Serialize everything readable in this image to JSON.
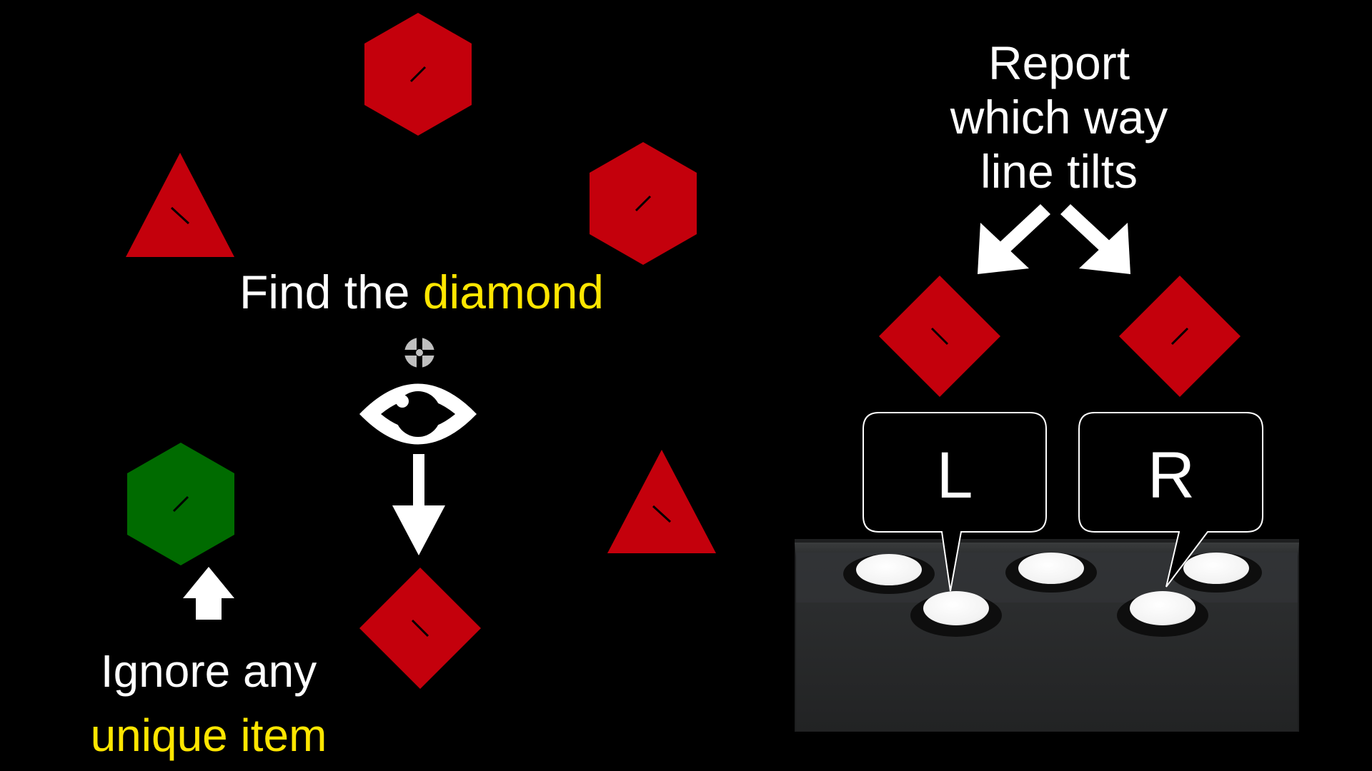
{
  "instructions": {
    "find_prefix": "Find the ",
    "find_target": "diamond",
    "ignore_line1": "Ignore any",
    "ignore_line2": "unique item",
    "report_line1": "Report",
    "report_line2": "which way",
    "report_line3": "line tilts"
  },
  "response_keys": {
    "left_label": "L",
    "right_label": "R"
  },
  "colors": {
    "background": "#000000",
    "distractor_red": "#c4000c",
    "singleton_green": "#006b00",
    "highlight_text": "#ffe600",
    "text": "#ffffff",
    "button_box": "#2d2f30",
    "button_cap": "#ffffff"
  },
  "icons": {
    "fixation": "fixation-cross-icon",
    "eye": "eye-icon",
    "arrows": "arrow-icon"
  }
}
